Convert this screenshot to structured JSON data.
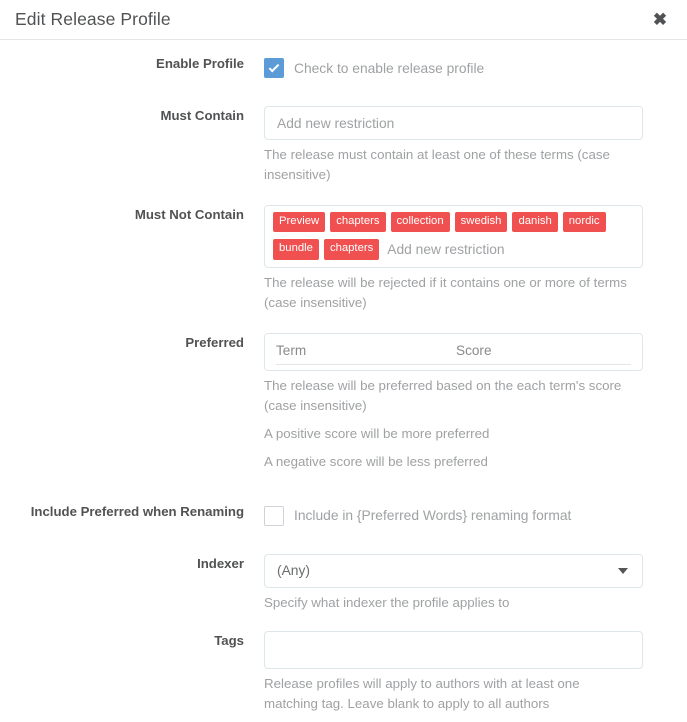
{
  "modal": {
    "title": "Edit Release Profile",
    "close_icon": "close-icon",
    "close_glyph": "✖"
  },
  "colors": {
    "tag_background": "#f05050",
    "checkbox_checked": "#5b9bd8",
    "border": "#dde6e9",
    "label_text": "#515253",
    "help_text": "#9fa1a3"
  },
  "form": {
    "enable_profile": {
      "label": "Enable Profile",
      "checkbox_label": "Check to enable release profile",
      "checked": true
    },
    "must_contain": {
      "label": "Must Contain",
      "placeholder": "Add new restriction",
      "tags": [],
      "help": "The release must contain at least one of these terms (case insensitive)"
    },
    "must_not_contain": {
      "label": "Must Not Contain",
      "placeholder": "Add new restriction",
      "tags": [
        "Preview",
        "chapters",
        "collection",
        "swedish",
        "danish",
        "nordic",
        "bundle",
        "chapters"
      ],
      "help": "The release will be rejected if it contains one or more of terms (case insensitive)"
    },
    "preferred": {
      "label": "Preferred",
      "column_term": "Term",
      "column_score": "Score",
      "help_1": "The release will be preferred based on the each term's score (case insensitive)",
      "help_2": "A positive score will be more preferred",
      "help_3": "A negative score will be less preferred"
    },
    "include_preferred": {
      "label": "Include Preferred when Renaming",
      "checkbox_label": "Include in {Preferred Words} renaming format",
      "checked": false
    },
    "indexer": {
      "label": "Indexer",
      "value": "(Any)",
      "caret_icon": "chevron-down-icon",
      "help": "Specify what indexer the profile applies to"
    },
    "tags": {
      "label": "Tags",
      "value": "",
      "help": "Release profiles will apply to authors with at least one matching tag. Leave blank to apply to all authors"
    }
  }
}
